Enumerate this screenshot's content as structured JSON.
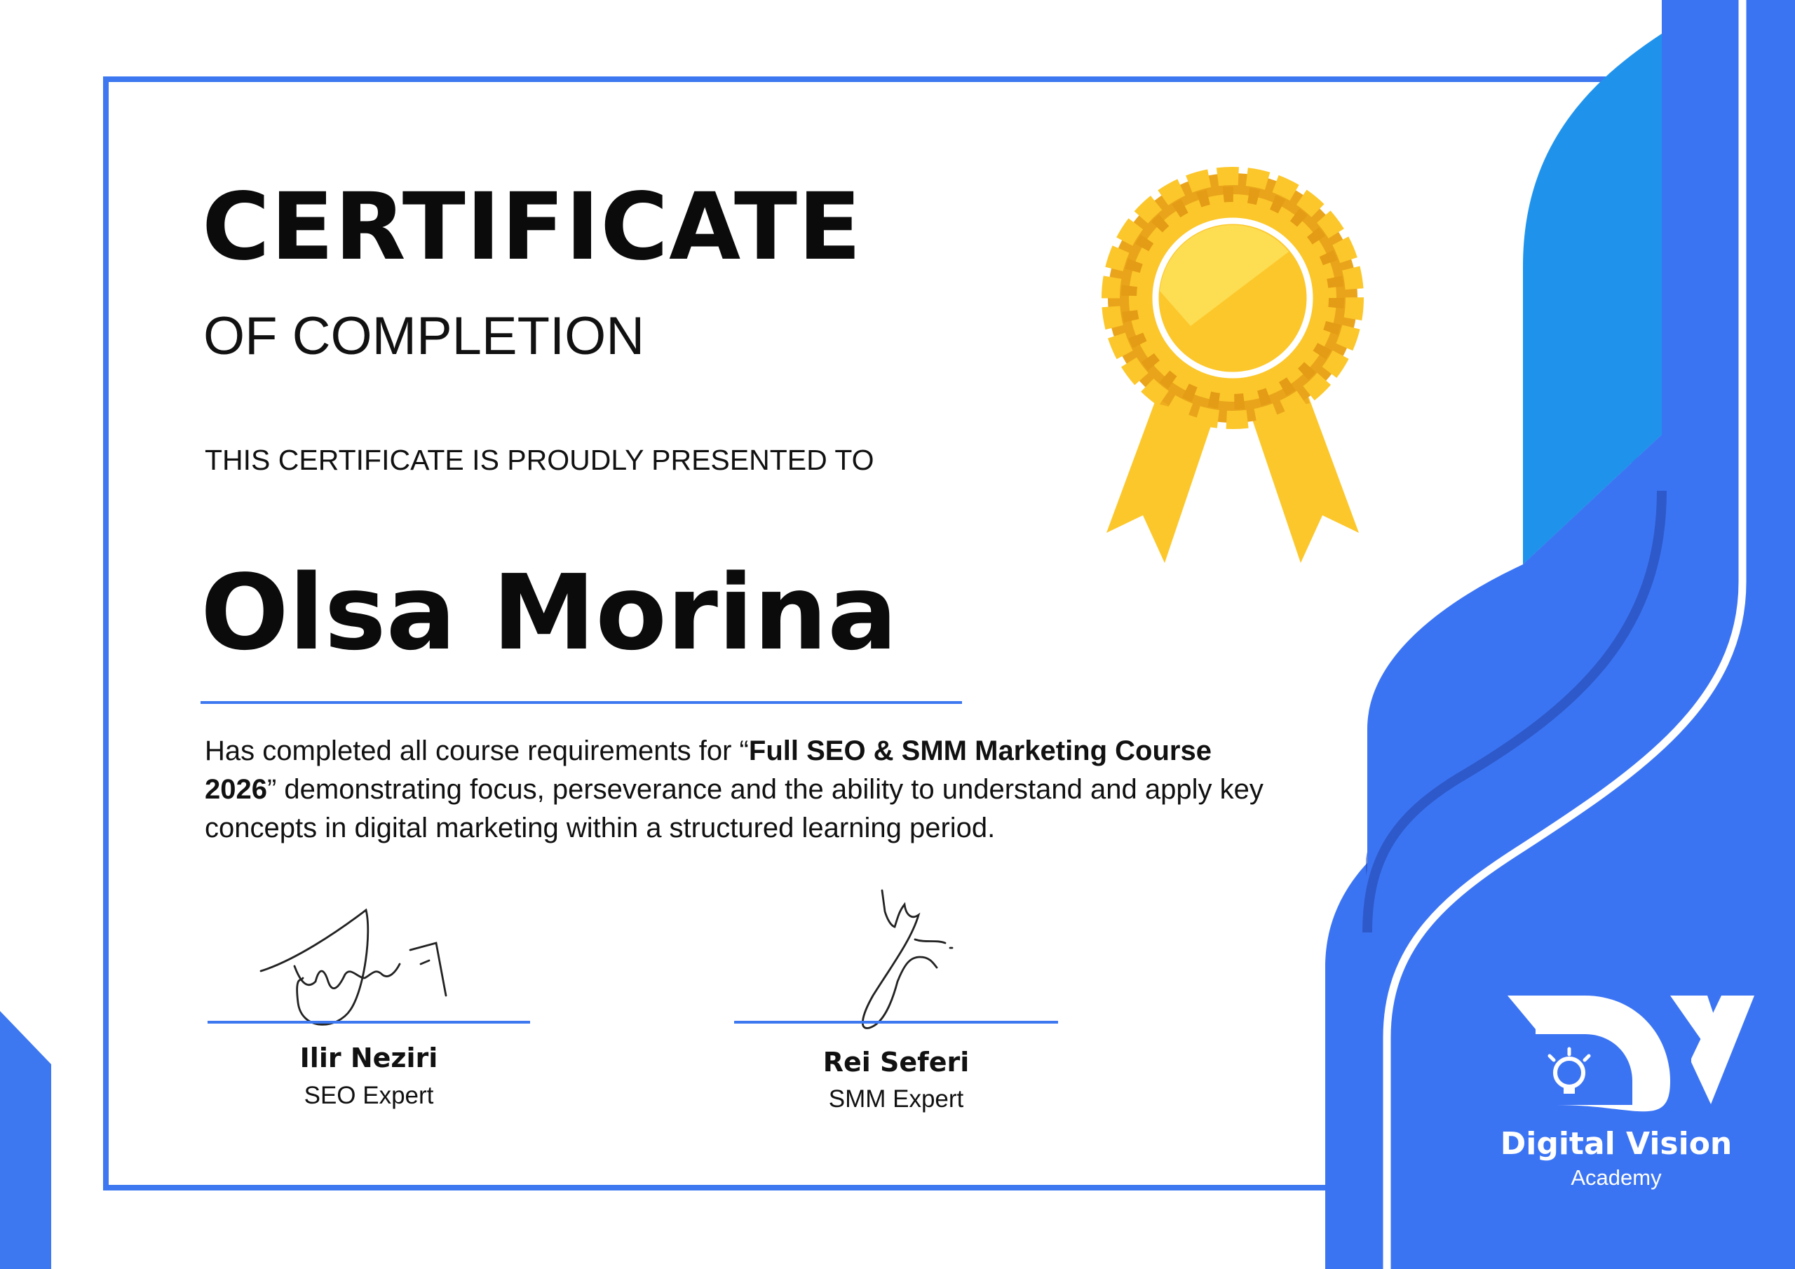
{
  "certificate": {
    "title": "CERTIFICATE",
    "subtitle": "OF COMPLETION",
    "presented_line": "THIS CERTIFICATE IS PROUDLY PRESENTED TO",
    "recipient_name": "Olsa Morina",
    "body": {
      "prefix": "Has completed all course requirements for “",
      "course_name": "Full SEO & SMM Marketing Course 2026",
      "suffix": "” demonstrating focus, perseverance and the ability to understand and apply key concepts in digital marketing within a structured learning period."
    }
  },
  "signatories": [
    {
      "name": "Ilir Neziri",
      "role": "SEO Expert"
    },
    {
      "name": "Rei Seferi",
      "role": "SMM Expert"
    }
  ],
  "brand": {
    "name": "Digital Vision",
    "sub": "Academy",
    "logo_icon": "dv-lightbulb-logo-icon"
  },
  "decor": {
    "award_icon": "gold-rosette-ribbon-icon",
    "signature_icons": [
      "handwritten-signature-icon",
      "handwritten-signature-icon"
    ]
  },
  "colors": {
    "frame_blue": "#3d78f0",
    "wave_blue": "#3b74f3",
    "wave_light_blue": "#1f93ec",
    "wave_dark_blue": "#2848a8",
    "gold": "#fcc72b",
    "gold_dark": "#e49b15",
    "text": "#111111"
  }
}
